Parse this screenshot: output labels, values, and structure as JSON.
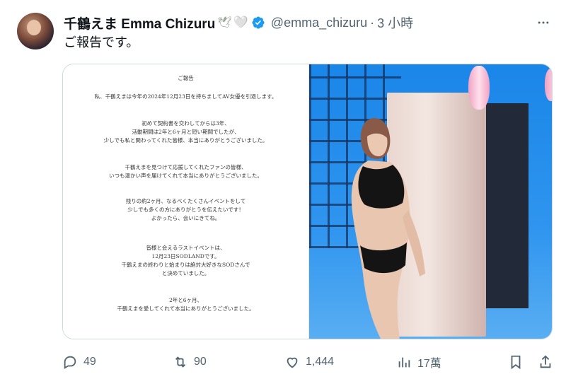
{
  "author": {
    "display_name": "千鶴えま Emma Chizuru",
    "name_emoji": "🕊",
    "heart_emoji": "🤍",
    "handle": "@emma_chizuru",
    "separator": "·",
    "time": "3 小時",
    "verified_color": "#1d9bf0"
  },
  "tweet": {
    "text": "ご報告です。"
  },
  "document": {
    "title": "ご報告",
    "paragraphs": [
      [
        "私、千鶴えまは今年の2024年12月23日を持ちましてAV女優を引退します。"
      ],
      [
        "初めて契約書を交わしてからは3年、",
        "活動期間は2年と6ヶ月と短い期間でしたが、",
        "少しでも私と関わってくれた皆様、本当にありがとうございました。"
      ],
      [
        "千鶴えまを見つけて応援してくれたファンの皆様、",
        "いつも温かい声を届けてくれて本当にありがとうございました。"
      ],
      [
        "残りの約2ヶ月、なるべくたくさんイベントをして",
        "少しでも多くの方にありがとうを伝えたいです！",
        "よかったら、会いにきてね。"
      ],
      [
        "皆様と会えるラストイベントは、",
        "12月23日SODLANDです。",
        "千鶴えまの終わりと始まりは絶対大好きなSODさんで",
        "と決めていました。"
      ],
      [
        "2年と6ヶ月、",
        "千鶴えまを愛してくれて本当にありがとうございました。"
      ]
    ]
  },
  "actions": {
    "reply_count": "49",
    "retweet_count": "90",
    "like_count": "1,444",
    "view_count": "17萬"
  }
}
